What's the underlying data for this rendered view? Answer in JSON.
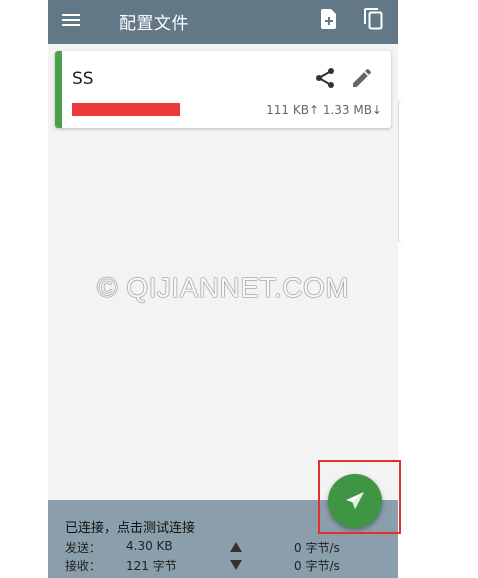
{
  "toolbar": {
    "title": "配置文件",
    "menu_icon": "menu-icon",
    "add_file_icon": "add-file-icon",
    "copy_icon": "copy-icon"
  },
  "profile_card": {
    "name": "SS",
    "traffic": "111 KB↑ 1.33 MB↓",
    "accent_color": "#4ba04a",
    "share_icon": "share-icon",
    "edit_icon": "edit-pencil-icon"
  },
  "watermark": "© QIJIANNET.COM",
  "status_bar": {
    "status_text": "已连接，点击测试连接",
    "upload_label": "发送：",
    "upload_value": "4.30 KB",
    "upload_rate": "0 字节/s",
    "download_label": "接收：",
    "download_value": "121 字节",
    "download_rate": "0 字节/s"
  },
  "fab": {
    "icon": "send-icon",
    "color": "#3f9543"
  },
  "colors": {
    "toolbar": "#627887",
    "status_bar": "#8a9eab",
    "highlight": "#e03030"
  }
}
